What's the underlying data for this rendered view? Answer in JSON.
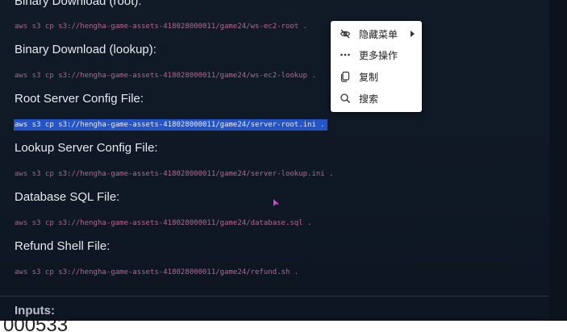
{
  "sections": [
    {
      "heading": "Binary Download (root):",
      "aws": "aws s3 cp ",
      "path": "s3://hengha-game-assets-418028000011/game24/ws-ec2-root",
      "dot": " ."
    },
    {
      "heading": "Binary Download (lookup):",
      "aws": "aws s3 cp ",
      "path": "s3://hengha-game-assets-418028000011/game24/ws-ec2-lookup",
      "dot": " ."
    },
    {
      "heading": "Root Server Config File:",
      "aws": "aws s3 cp ",
      "path": "s3://hengha-game-assets-418028000011/game24/server-root.ini",
      "dot": " ."
    },
    {
      "heading": "Lookup Server Config File:",
      "aws": "aws s3 cp ",
      "path": "s3://hengha-game-assets-418028000011/game24/server-lookup.ini",
      "dot": " ."
    },
    {
      "heading": "Database SQL File:",
      "aws": "aws s3 cp ",
      "path": "s3://hengha-game-assets-418028000011/game24/database.sql",
      "dot": " ."
    },
    {
      "heading": "Refund Shell File:",
      "aws": "aws s3 cp ",
      "path": "s3://hengha-game-assets-418028000011/game24/refund.sh",
      "dot": " ."
    }
  ],
  "inputs_label": "Inputs:",
  "bottom_number": "000533",
  "context_menu": {
    "items": [
      {
        "label": "隐藏菜单",
        "icon": "eye-off-icon",
        "has_submenu": true
      },
      {
        "label": "更多操作",
        "icon": "more-dots-icon",
        "has_submenu": false
      },
      {
        "label": "复制",
        "icon": "copy-icon",
        "has_submenu": false
      },
      {
        "label": "搜索",
        "icon": "search-icon",
        "has_submenu": false
      }
    ]
  },
  "colors": {
    "background": "#0f1722",
    "selection": "#2455c8",
    "command_text": "#b06a93",
    "heading_text": "#e6e9ef",
    "cursor": "#d04ac8"
  }
}
